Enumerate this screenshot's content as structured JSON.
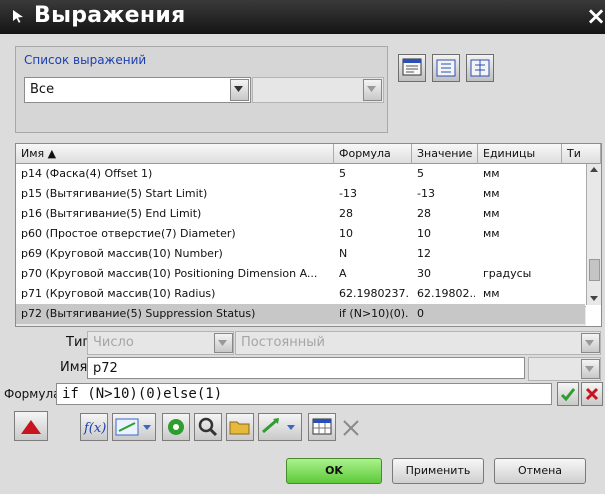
{
  "window": {
    "title": "Выражения",
    "close_glyph": "×"
  },
  "expression_list": {
    "title": "Список выражений",
    "filter_value": "Все",
    "filter2_value": ""
  },
  "table": {
    "columns": {
      "name": "Имя ▲",
      "formula": "Формула",
      "value": "Значение",
      "units": "Единицы",
      "type": "Ти"
    },
    "rows": [
      {
        "name": "p14  (Фаска(4) Offset 1)",
        "formula": "5",
        "value": "5",
        "units": "мм"
      },
      {
        "name": "p15  (Вытягивание(5) Start Limit)",
        "formula": "-13",
        "value": "-13",
        "units": "мм"
      },
      {
        "name": "p16  (Вытягивание(5) End Limit)",
        "formula": "28",
        "value": "28",
        "units": "мм"
      },
      {
        "name": "p60  (Простое отверстие(7) Diameter)",
        "formula": "10",
        "value": "10",
        "units": "мм"
      },
      {
        "name": "p69  (Круговой массив(10) Number)",
        "formula": "N",
        "value": "12",
        "units": ""
      },
      {
        "name": "p70  (Круговой массив(10) Positioning Dimension A...",
        "formula": "A",
        "value": "30",
        "units": "градусы"
      },
      {
        "name": "p71  (Круговой массив(10) Radius)",
        "formula": "62.1980237...",
        "value": "62.19802...",
        "units": "мм"
      },
      {
        "name": "p72  (Вытягивание(5) Suppression Status)",
        "formula": "if (N>10)(0)...",
        "value": "0",
        "units": ""
      }
    ]
  },
  "form": {
    "type_label": "Тип",
    "type_value": "Число",
    "type2_value": "Постоянный",
    "name_label": "Имя",
    "name_value": "p72",
    "formula_label": "Формула",
    "formula_value": "if (N>10)(0)else(1)"
  },
  "buttons": {
    "ok": "OK",
    "apply": "Применить",
    "cancel": "Отмена"
  },
  "colors": {
    "titlebar": "#1f1f1f",
    "ok_green": "#7ee05a",
    "group_title": "#1b3fb0",
    "delete_red": "#c8141e"
  }
}
